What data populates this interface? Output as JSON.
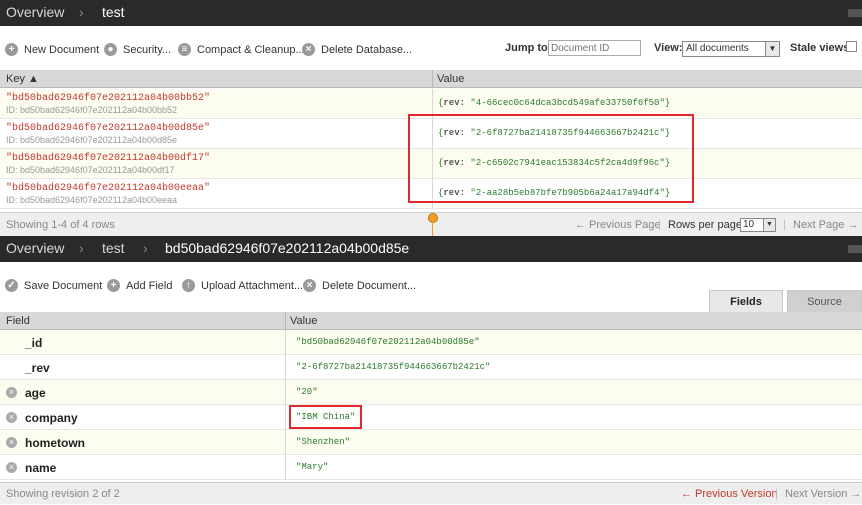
{
  "top": {
    "breadcrumb": [
      "Overview",
      "test"
    ],
    "separator": "›",
    "toolbar": {
      "new_document": "New Document",
      "security": "Security...",
      "compact": "Compact & Cleanup...",
      "delete_db": "Delete Database...",
      "jump_label": "Jump to:",
      "jump_placeholder": "Document ID",
      "view_label": "View:",
      "view_selected": "All documents",
      "stale_label": "Stale views"
    },
    "columns": {
      "key": "Key ▲",
      "value": "Value"
    },
    "rows": [
      {
        "key": "\"bd50bad62946f07e202112a04b00bb52\"",
        "id": "ID: bd50bad62946f07e202112a04b00bb52",
        "rev_label": "rev:",
        "rev": "\"4-66cec0c64dca3bcd549afe33750f6f50\""
      },
      {
        "key": "\"bd50bad62946f07e202112a04b00d85e\"",
        "id": "ID: bd50bad62946f07e202112a04b00d85e",
        "rev_label": "rev:",
        "rev": "\"2-6f8727ba21418735f944663667b2421c\""
      },
      {
        "key": "\"bd50bad62946f07e202112a04b00df17\"",
        "id": "ID: bd50bad62946f07e202112a04b00df17",
        "rev_label": "rev:",
        "rev": "\"2-c6502c7941eac153834c5f2ca4d9f96c\""
      },
      {
        "key": "\"bd50bad62946f07e202112a04b00eeaa\"",
        "id": "ID: bd50bad62946f07e202112a04b00eeaa",
        "rev_label": "rev:",
        "rev": "\"2-aa28b5eb87bfe7b905b6a24a17a94df4\""
      }
    ],
    "footer": {
      "showing": "Showing 1-4 of 4 rows",
      "prev": "← Previous Page",
      "rows_per_page": "Rows per page:",
      "rows_value": "10",
      "next": "Next Page →"
    }
  },
  "bottom": {
    "breadcrumb": [
      "Overview",
      "test",
      "bd50bad62946f07e202112a04b00d85e"
    ],
    "separator": "›",
    "toolbar": {
      "save": "Save Document",
      "add_field": "Add Field",
      "upload": "Upload Attachment...",
      "delete_doc": "Delete Document..."
    },
    "tabs": {
      "fields": "Fields",
      "source": "Source"
    },
    "columns": {
      "field": "Field",
      "value": "Value"
    },
    "fields": [
      {
        "name": "_id",
        "value": "\"bd50bad62946f07e202112a04b00d85e\""
      },
      {
        "name": "_rev",
        "value": "\"2-6f8727ba21418735f944663667b2421c\""
      },
      {
        "name": "age",
        "value": "\"20\""
      },
      {
        "name": "company",
        "value": "\"IBM China\""
      },
      {
        "name": "hometown",
        "value": "\"Shenzhen\""
      },
      {
        "name": "name",
        "value": "\"Mary\""
      }
    ],
    "footer": {
      "showing": "Showing revision 2 of 2",
      "prev": "← Previous Version",
      "next": "Next Version →"
    }
  },
  "colors": {
    "highlight": "#e0282d",
    "key_text": "#c0392b",
    "value_text": "#2a7a2a",
    "titlebar": "#2a2a2a"
  }
}
